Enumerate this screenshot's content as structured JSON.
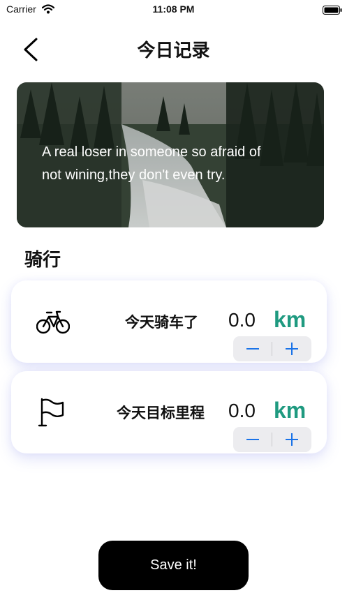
{
  "status_bar": {
    "carrier": "Carrier",
    "time": "11:08 PM"
  },
  "header": {
    "title": "今日记录",
    "back_icon": "chevron-left-icon"
  },
  "banner": {
    "quote": "A real loser in someone so afraid of not wining,they don't even try."
  },
  "section": {
    "title": "骑行"
  },
  "cards": [
    {
      "icon": "bicycle-icon",
      "label": "今天骑车了",
      "value": "0.0",
      "unit": "km"
    },
    {
      "icon": "flag-icon",
      "label": "今天目标里程",
      "value": "0.0",
      "unit": "km"
    }
  ],
  "colors": {
    "accent_unit": "#1f9a80",
    "stepper_icon": "#1a73e8",
    "button_bg": "#000000"
  },
  "save_button": {
    "label": "Save it!"
  }
}
